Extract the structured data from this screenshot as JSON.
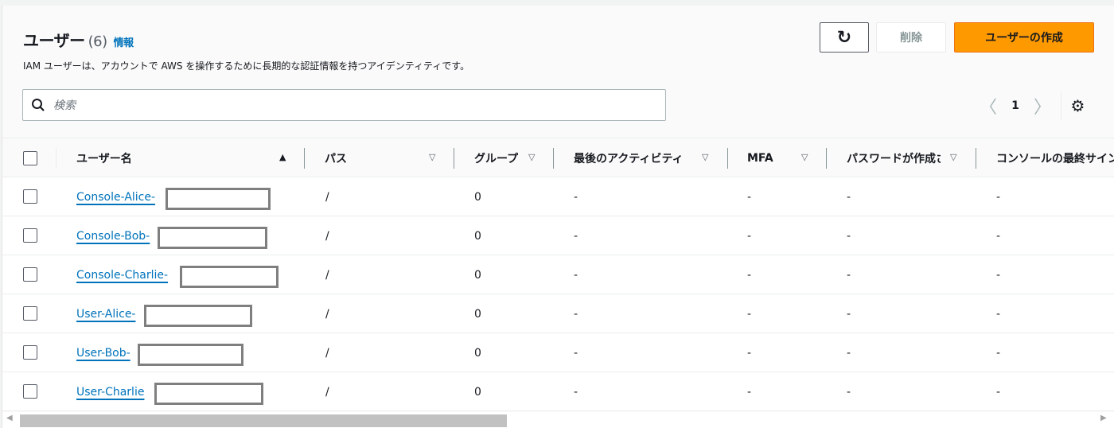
{
  "header": {
    "title": "ユーザー",
    "count": "(6)",
    "info": "情報",
    "description": "IAM ユーザーは、アカウントで AWS を操作するために長期的な認証情報を持つアイデンティティです。"
  },
  "actions": {
    "refresh": "↻",
    "delete": "削除",
    "create": "ユーザーの作成"
  },
  "search": {
    "placeholder": "検索"
  },
  "pagination": {
    "prev": "〈",
    "page": "1",
    "next": "〉"
  },
  "columns": [
    "ユーザー名",
    "パス",
    "グループ",
    "最後のアクティビティ",
    "MFA",
    "パスワードが作成されてからの時間",
    "コンソールの最終サインイン"
  ],
  "rows": [
    {
      "name": "Console-Alice-",
      "path": "/",
      "groups": "0",
      "last_activity": "-",
      "mfa": "-",
      "password_age": "-",
      "console_last": "-"
    },
    {
      "name": "Console-Bob-",
      "path": "/",
      "groups": "0",
      "last_activity": "-",
      "mfa": "-",
      "password_age": "-",
      "console_last": "-"
    },
    {
      "name": "Console-Charlie-",
      "path": "/",
      "groups": "0",
      "last_activity": "-",
      "mfa": "-",
      "password_age": "-",
      "console_last": "-"
    },
    {
      "name": "User-Alice-",
      "path": "/",
      "groups": "0",
      "last_activity": "-",
      "mfa": "-",
      "password_age": "-",
      "console_last": "-"
    },
    {
      "name": "User-Bob-",
      "path": "/",
      "groups": "0",
      "last_activity": "-",
      "mfa": "-",
      "password_age": "-",
      "console_last": "-"
    },
    {
      "name": "User-Charlie",
      "path": "/",
      "groups": "0",
      "last_activity": "-",
      "mfa": "-",
      "password_age": "-",
      "console_last": "-"
    }
  ],
  "colors": {
    "accent": "#ff9900",
    "link": "#0073bb"
  }
}
